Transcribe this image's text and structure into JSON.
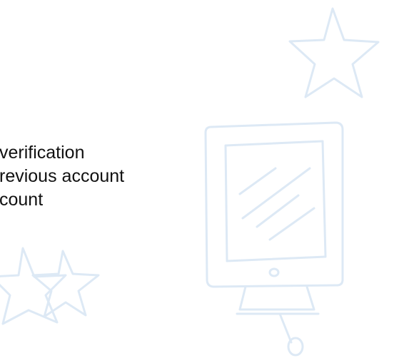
{
  "lines": [
    "verification",
    "revious account",
    "count"
  ],
  "colors": {
    "text": "#111111",
    "decor": "#dde9f5",
    "decor_fill": "#f3f8fd"
  },
  "icons": {
    "top_right": "star-outline-icon",
    "bottom_left": "star-outline-icon",
    "center_right": "computer-monitor-icon"
  }
}
